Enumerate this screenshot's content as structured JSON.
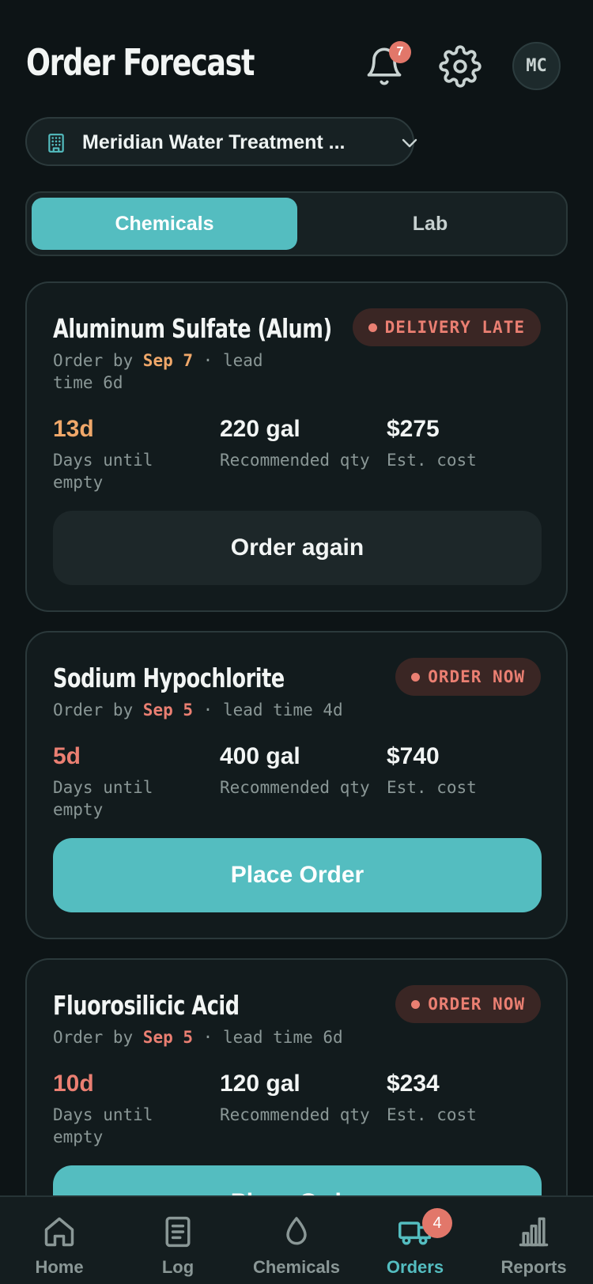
{
  "header": {
    "title": "Order Forecast",
    "notifications_count": "7",
    "avatar_initials": "MC"
  },
  "facility": {
    "name": "Meridian Water Treatment ..."
  },
  "tabs": [
    {
      "label": "Chemicals",
      "active": true
    },
    {
      "label": "Lab",
      "active": false
    }
  ],
  "cards": [
    {
      "name": "Aluminum Sulfate (Alum)",
      "status": "DELIVERY LATE",
      "order_by_prefix": "Order by ",
      "order_by_date": "Sep 7",
      "order_by_suffix_1": " · lead",
      "order_by_suffix_2": "time 6d",
      "days": "13d",
      "days_label": "Days until empty",
      "qty": "220 gal",
      "qty_label": "Recommended qty",
      "cost": "$275",
      "cost_label": "Est. cost",
      "button": "Order again"
    },
    {
      "name": "Sodium Hypochlorite",
      "status": "ORDER NOW",
      "order_by_prefix": "Order by ",
      "order_by_date": "Sep 5",
      "order_by_suffix": " · lead time 4d",
      "days": "5d",
      "days_label": "Days until empty",
      "qty": "400 gal",
      "qty_label": "Recommended qty",
      "cost": "$740",
      "cost_label": "Est. cost",
      "button": "Place Order"
    },
    {
      "name": "Fluorosilicic Acid",
      "status": "ORDER NOW",
      "order_by_prefix": "Order by ",
      "order_by_date": "Sep 5",
      "order_by_suffix": " · lead time 6d",
      "days": "10d",
      "days_label": "Days until empty",
      "qty": "120 gal",
      "qty_label": "Recommended qty",
      "cost": "$234",
      "cost_label": "Est. cost",
      "button": "Place Order"
    }
  ],
  "bottom_nav": [
    {
      "label": "Home",
      "icon": "home-icon"
    },
    {
      "label": "Log",
      "icon": "log-icon"
    },
    {
      "label": "Chemicals",
      "icon": "droplet-icon"
    },
    {
      "label": "Orders",
      "icon": "truck-icon",
      "badge": "4",
      "active": true
    },
    {
      "label": "Reports",
      "icon": "bar-chart-icon"
    }
  ],
  "colors": {
    "accent": "#54bdc0",
    "alert": "#ea7f72",
    "warning": "#f0a86a",
    "background": "#0d1416",
    "card": "#121b1d"
  }
}
